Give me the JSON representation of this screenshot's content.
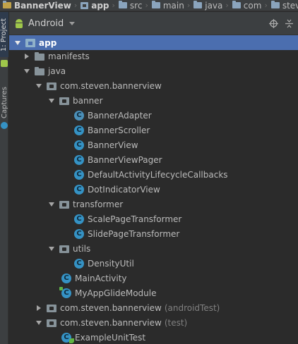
{
  "breadcrumb": [
    {
      "label": "BannerView",
      "icon": "project-folder-icon",
      "bold": true
    },
    {
      "label": "app",
      "icon": "module-icon",
      "bold": true
    },
    {
      "label": "src",
      "icon": "folder-icon"
    },
    {
      "label": "main",
      "icon": "folder-icon"
    },
    {
      "label": "java",
      "icon": "folder-icon"
    },
    {
      "label": "com",
      "icon": "folder-icon"
    },
    {
      "label": "stev",
      "icon": "folder-icon"
    }
  ],
  "side_tabs": {
    "project": "1: Project",
    "captures": "Captures"
  },
  "tool_window": {
    "view_mode": "Android"
  },
  "tree": {
    "app": "app",
    "manifests": "manifests",
    "java": "java",
    "pkg_main": "com.steven.bannerview",
    "banner": "banner",
    "banner_items": [
      "BannerAdapter",
      "BannerScroller",
      "BannerView",
      "BannerViewPager",
      "DefaultActivityLifecycleCallbacks",
      "DotIndicatorView"
    ],
    "transformer": "transformer",
    "transformer_items": [
      "ScalePageTransformer",
      "SlidePageTransformer"
    ],
    "utils": "utils",
    "utils_items": [
      "DensityUtil"
    ],
    "main_activity": "MainActivity",
    "glide_module": "MyAppGlideModule",
    "pkg_android_test": "com.steven.bannerview",
    "pkg_android_test_hint": "(androidTest)",
    "pkg_test": "com.steven.bannerview",
    "pkg_test_hint": "(test)",
    "example_unit_test": "ExampleUnitTest"
  },
  "colors": {
    "background": "#2b2b2b",
    "panel": "#3c3f41",
    "selection": "#4b6eaf",
    "class_icon": "#3592c4"
  }
}
